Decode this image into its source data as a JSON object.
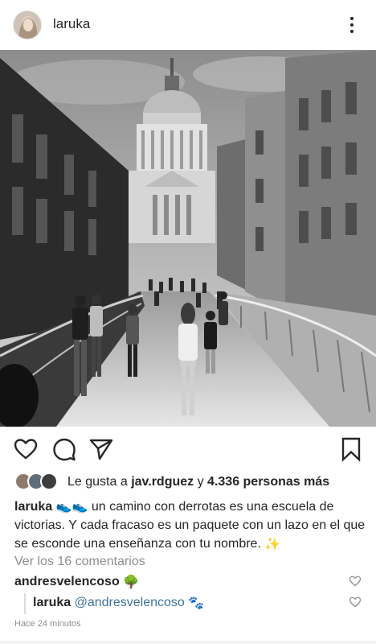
{
  "post": {
    "username": "laruka",
    "menu_icon": "more-vertical-icon",
    "photo_description_icon": "photo"
  },
  "actions": {
    "like_icon": "heart-icon",
    "comment_icon": "comment-icon",
    "share_icon": "send-icon",
    "save_icon": "bookmark-icon"
  },
  "likes": {
    "prefix": "Le gusta a",
    "user": "jav.rdguez",
    "connector": "y",
    "count_text": "4.336 personas más"
  },
  "caption": {
    "username": "laruka",
    "emoji_1": "👟👟",
    "text": "un camino con derrotas es una escuela de victorias. Y cada fracaso es un paquete con un lazo en el que se esconde una enseñanza con tu nombre.",
    "emoji_2": "✨"
  },
  "view_all_comments": "Ver los 16 comentarios",
  "comments": [
    {
      "username": "andresvelencoso",
      "text": "",
      "emoji": "🌳"
    },
    {
      "username": "laruka",
      "mention": "@andresvelencoso",
      "emoji": "🐾"
    }
  ],
  "timestamp": "Hace 24 minutos",
  "colors": {
    "text": "#262626",
    "muted": "#8e8e8e",
    "mention": "#3f729b",
    "background": "#ffffff"
  }
}
